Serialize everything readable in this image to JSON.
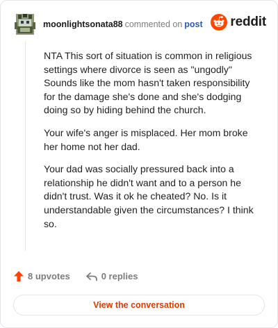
{
  "header": {
    "username": "moonlightsonata88",
    "action": "commented on",
    "post_link": "post",
    "brand": "reddit",
    "brand_color": "#ff4500"
  },
  "comment": {
    "paragraphs": [
      "NTA This sort of situation is common in religious settings where divorce is seen as \"ungodly\" Sounds like the mom hasn't taken responsibility for the damage she's done and she's dodging doing so by hiding behind the church.",
      "Your wife's anger is misplaced. Her mom broke her home not her dad.",
      "Your dad was socially pressured back into a relationship he didn't want and to a person he didn't trust. Was it ok he cheated? No. Is it understandable given the circumstances? I think so."
    ]
  },
  "actions": {
    "upvotes": "8 upvotes",
    "replies": "0 replies",
    "upvote_icon": "upvote-arrow-icon",
    "reply_icon": "reply-arrow-icon"
  },
  "cta": {
    "label": "View the conversation"
  }
}
